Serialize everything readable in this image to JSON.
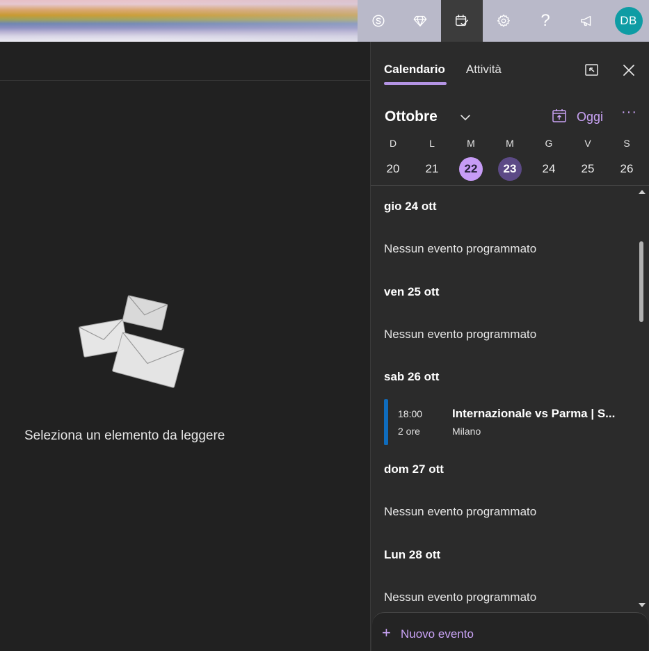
{
  "header": {
    "toolbar": {
      "skype": "skype-icon",
      "premium": "diamond-icon",
      "my_day": "calendar-check-icon",
      "settings": "gear-icon",
      "help_label": "?",
      "feedback": "megaphone-icon",
      "avatar_initials": "DB"
    },
    "colors": {
      "avatar_bg": "#0e9ca4",
      "toolbar_bg": "#b9b9c9"
    }
  },
  "reading_pane": {
    "empty_message": "Seleziona un elemento da leggere",
    "illustration": "envelopes-illustration"
  },
  "side_panel": {
    "tabs": [
      {
        "label": "Calendario",
        "active": true
      },
      {
        "label": "Attività",
        "active": false
      }
    ],
    "month": "Ottobre",
    "today_label": "Oggi",
    "more_label": "···",
    "week": [
      {
        "letter": "D",
        "day": "20",
        "state": ""
      },
      {
        "letter": "L",
        "day": "21",
        "state": ""
      },
      {
        "letter": "M",
        "day": "22",
        "state": "selected"
      },
      {
        "letter": "M",
        "day": "23",
        "state": "today"
      },
      {
        "letter": "G",
        "day": "24",
        "state": ""
      },
      {
        "letter": "V",
        "day": "25",
        "state": ""
      },
      {
        "letter": "S",
        "day": "26",
        "state": ""
      }
    ],
    "agenda": [
      {
        "header": "gio 24 ott",
        "no_events": "Nessun evento programmato"
      },
      {
        "header": "ven 25 ott",
        "no_events": "Nessun evento programmato"
      },
      {
        "header": "sab 26 ott",
        "event": {
          "time": "18:00",
          "duration": "2 ore",
          "title": "Internazionale vs Parma | S...",
          "location": "Milano"
        }
      },
      {
        "header": "dom 27 ott",
        "no_events": "Nessun evento programmato"
      },
      {
        "header": "Lun 28 ott",
        "no_events": "Nessun evento programmato"
      }
    ],
    "new_event": {
      "plus": "+",
      "label": "Nuovo evento"
    },
    "colors": {
      "accent": "#c9a3f5",
      "selected_day": "#c79cf6",
      "today_day": "#5c4a86",
      "event_bar": "#0f6cbd"
    }
  }
}
